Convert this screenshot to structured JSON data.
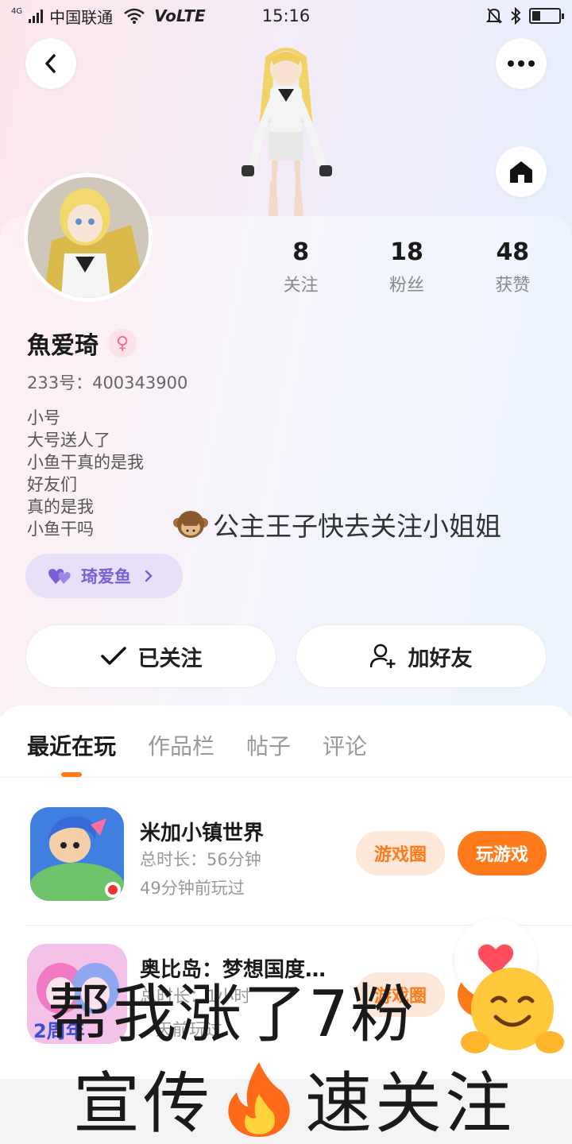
{
  "status_bar": {
    "network": "4G",
    "carrier": "中国联通",
    "volte": "VoLTE",
    "time": "15:16"
  },
  "profile": {
    "name": "魚爱琦",
    "uid": "233号：400343900",
    "bio_lines": [
      "小号",
      "大号送人了",
      "小鱼干真的是我",
      "好友们",
      "真的是我",
      "小鱼干吗"
    ],
    "bio_extra": "公主王子快去关注小姐姐",
    "tag_label": "琦爱鱼"
  },
  "stats": [
    {
      "value": "8",
      "label": "关注"
    },
    {
      "value": "18",
      "label": "粉丝"
    },
    {
      "value": "48",
      "label": "获赞"
    }
  ],
  "actions": {
    "following_label": "已关注",
    "add_friend_label": "加好友"
  },
  "tabs": [
    {
      "label": "最近在玩"
    },
    {
      "label": "作品栏"
    },
    {
      "label": "帖子"
    },
    {
      "label": "评论"
    }
  ],
  "games": [
    {
      "name": "米加小镇世界",
      "duration": "总时长：56分钟",
      "last_played": "49分钟前玩过",
      "circle_label": "游戏圈",
      "play_label": "玩游戏"
    },
    {
      "name": "奥比岛：梦想国度…",
      "duration": "总时长：1小时",
      "last_played": "天前玩过",
      "circle_label": "游戏圈",
      "play_label": "玩游戏",
      "icon_text": "2周年"
    }
  ],
  "overlay": {
    "line1": "帮我涨了7粉",
    "line2a": "宣传",
    "line2b": "速关注"
  },
  "colors": {
    "accent": "#ff7a1a",
    "tag_purple": "#7b5fd6",
    "female_pink": "#f1708f"
  }
}
